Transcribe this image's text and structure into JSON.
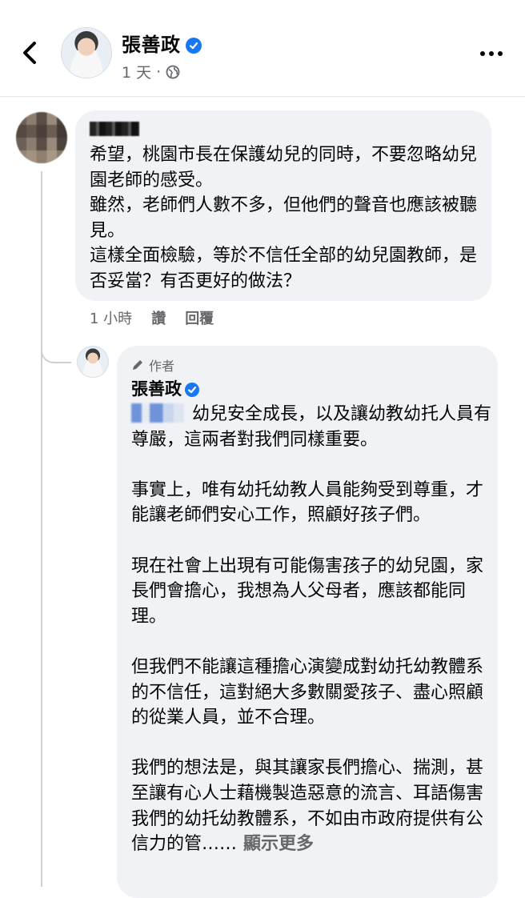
{
  "header": {
    "author_name": "張善政",
    "post_time": "1 天",
    "meta_separator": "·",
    "privacy_icon": "globe-icon",
    "back_icon": "chevron-left-icon",
    "more_icon": "more-horizontal-icon"
  },
  "comment": {
    "lines": [
      "希望，桃園市長在保護幼兒的同時，不要忽略幼兒園老師的感受。",
      "雖然，老師們人數不多，但他們的聲音也應該被聽見。",
      "這樣全面檢驗，等於不信任全部的幼兒園教師，是否妥當？有否更好的做法？"
    ],
    "time": "1 小時",
    "like_label": "讚",
    "reply_label": "回覆"
  },
  "reply": {
    "author_tag": "作者",
    "author_name": "張善政",
    "paragraphs": [
      "幼兒安全成長，以及讓幼教幼托人員有尊嚴，這兩者對我們同樣重要。",
      "事實上，唯有幼托幼教人員能夠受到尊重，才能讓老師們安心工作，照顧好孩子們。",
      "現在社會上出現有可能傷害孩子的幼兒園，家長們會擔心，我想為人父母者，應該都能同理。",
      "但我們不能讓這種擔心演變成對幼托幼教體系的不信任，這對絕大多數關愛孩子、盡心照顧的從業人員，並不合理。",
      "我們的想法是，與其讓家長們擔心、揣測，甚至讓有心人士藉機製造惡意的流言、耳語傷害我們的幼托幼教體系，不如由市政府提供有公信力的管……"
    ],
    "see_more_label": "顯示更多"
  },
  "colors": {
    "verified": "#1877f2",
    "bubble": "#f0f2f5",
    "secondary_text": "#65676b"
  }
}
